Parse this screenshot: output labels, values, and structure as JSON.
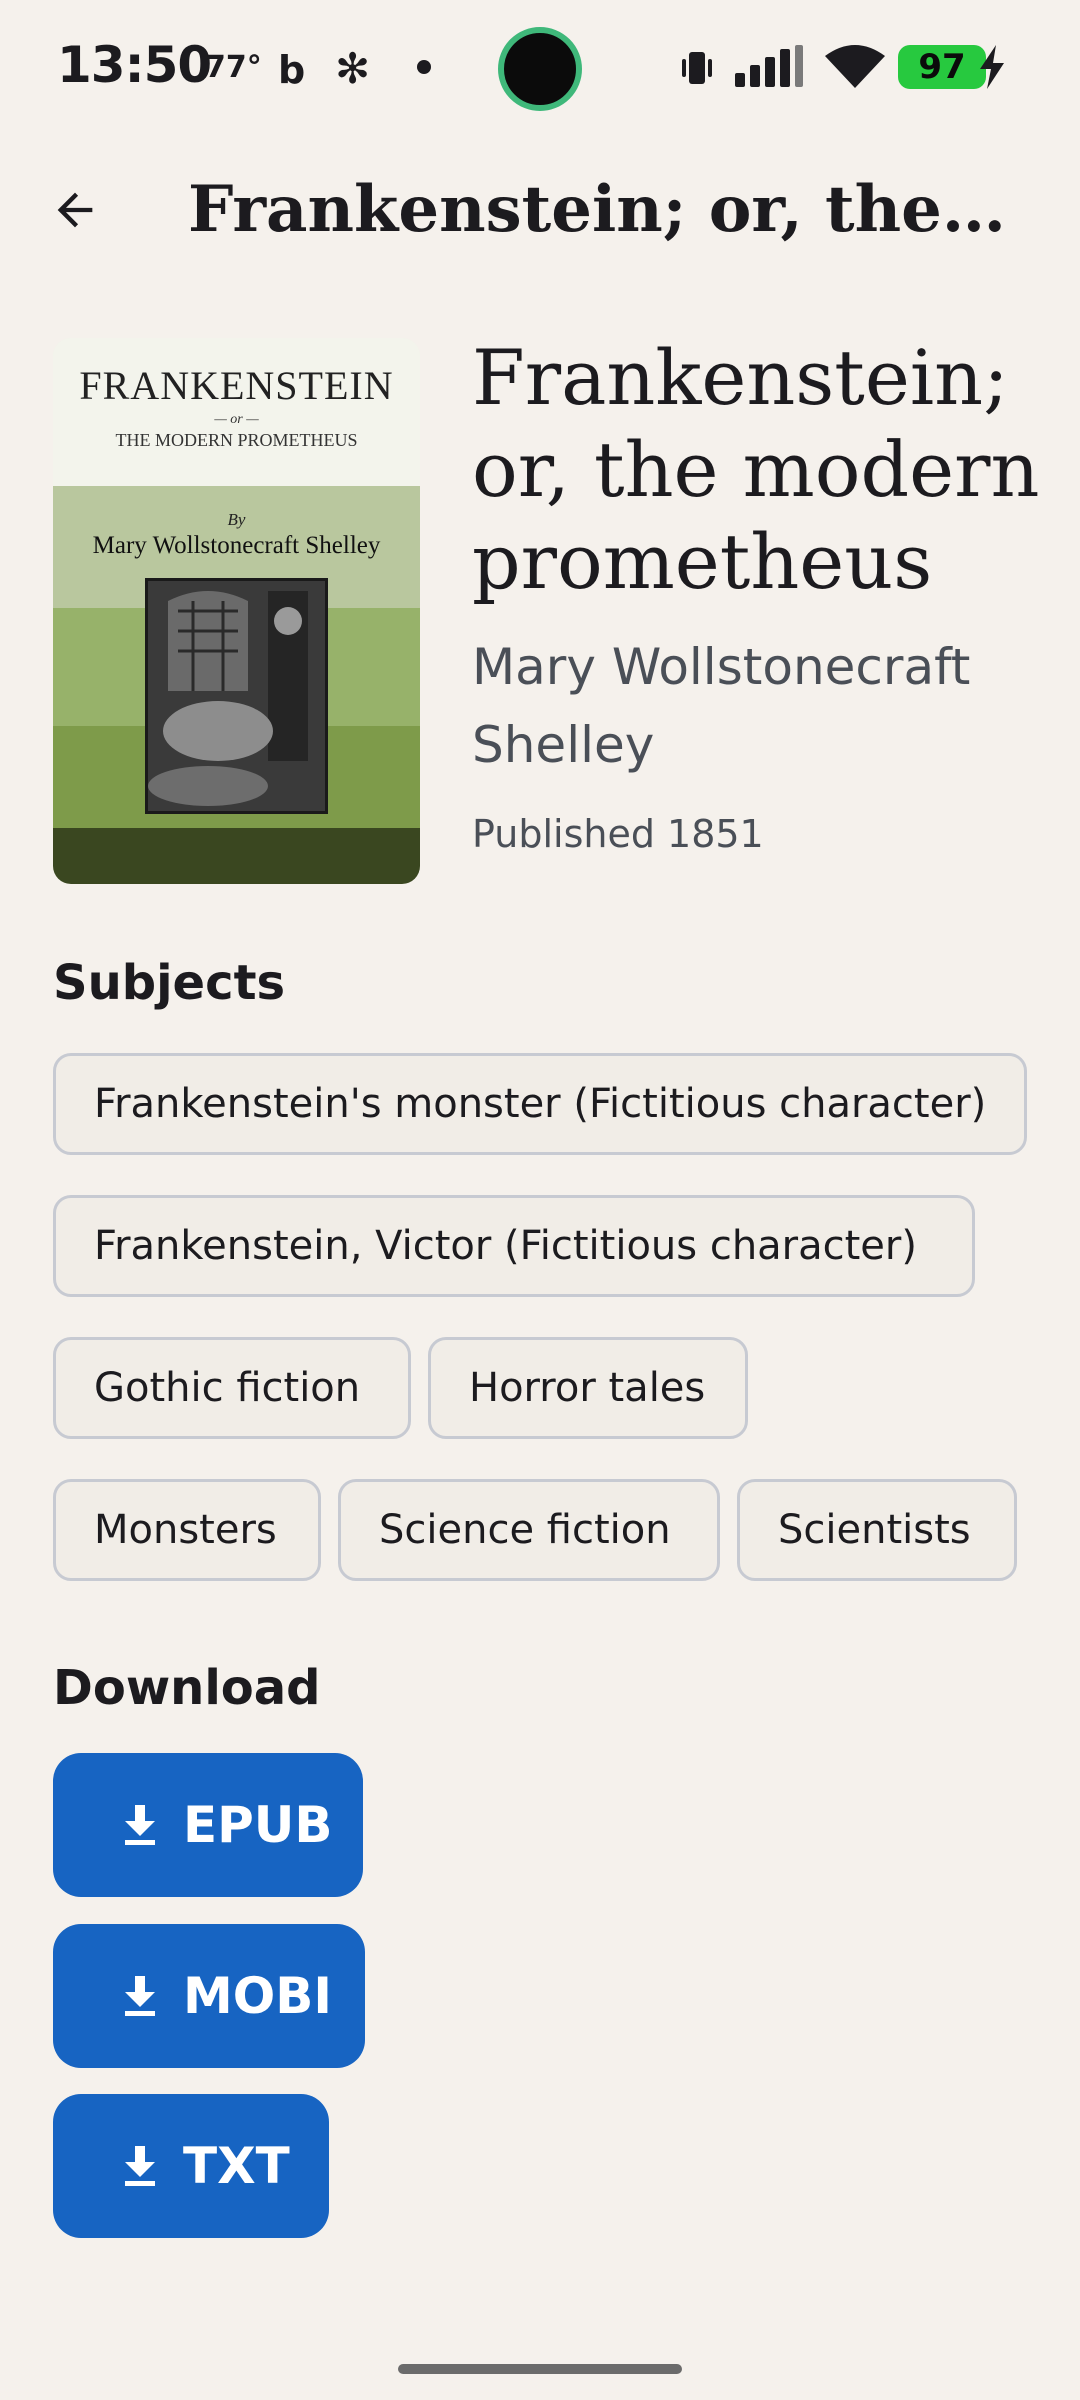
{
  "status_bar": {
    "time": "13:50",
    "temperature": "77°",
    "battery": "97",
    "battery_color": "#27c93f"
  },
  "app_bar": {
    "title": "Frankenstein; or, the modern prometheus"
  },
  "cover": {
    "title": "FRANKENSTEIN",
    "or": "— or —",
    "subtitle": "THE MODERN PROMETHEUS",
    "by": "By",
    "author": "Mary Wollstonecraft Shelley"
  },
  "book": {
    "title": "Frankenstein; or, the modern prometheus",
    "author": "Mary Wollstonecraft Shelley",
    "published": "Published 1851"
  },
  "subjects": {
    "heading": "Subjects",
    "items": [
      "Frankenstein's monster (Fictitious character)",
      "Frankenstein, Victor (Fictitious character)",
      "Gothic fiction",
      "Horror tales",
      "Monsters",
      "Science fiction",
      "Scientists"
    ]
  },
  "download": {
    "heading": "Download",
    "buttons": [
      "EPUB",
      "MOBI",
      "TXT"
    ],
    "button_color": "#1764c2"
  },
  "icons": {
    "back": "arrow-back-icon",
    "download": "download-icon"
  }
}
